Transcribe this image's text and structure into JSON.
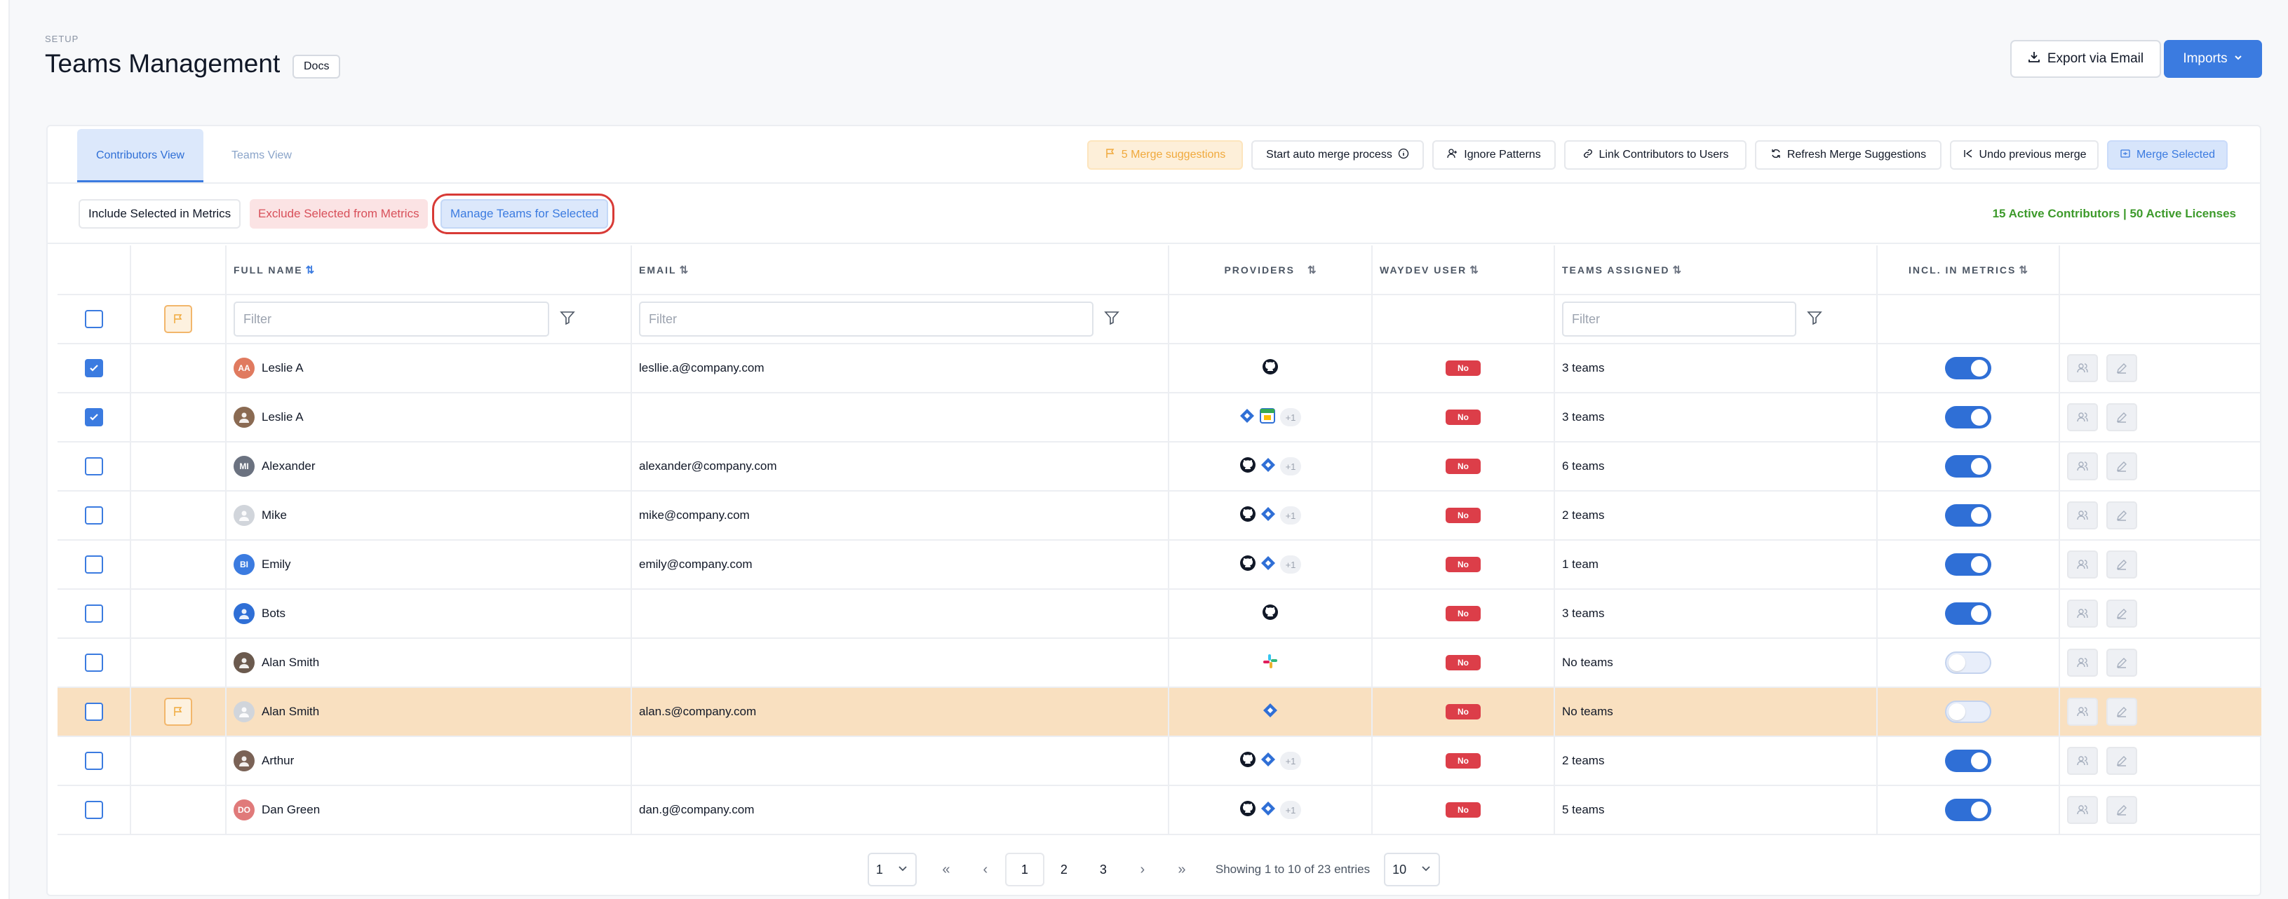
{
  "header": {
    "section": "SETUP",
    "title": "Teams Management",
    "docs_label": "Docs",
    "export_label": "Export via Email",
    "imports_label": "Imports"
  },
  "tabs": [
    {
      "label": "Contributors View",
      "active": true
    },
    {
      "label": "Teams View",
      "active": false
    }
  ],
  "toolbar": {
    "merge_suggestions": "5 Merge suggestions",
    "auto_merge": "Start auto merge process",
    "ignore_patterns": "Ignore Patterns",
    "link_contributors": "Link Contributors to Users",
    "refresh_merge": "Refresh Merge Suggestions",
    "undo_merge": "Undo previous merge",
    "merge_selected": "Merge Selected"
  },
  "actions": {
    "include_selected": "Include Selected in Metrics",
    "exclude_selected": "Exclude Selected from Metrics",
    "manage_teams": "Manage Teams for Selected",
    "active_summary": "15 Active Contributors | 50 Active Licenses"
  },
  "columns": {
    "full_name": "FULL NAME",
    "email": "EMAIL",
    "providers": "PROVIDERS",
    "waydev_user": "WAYDEV USER",
    "teams_assigned": "TEAMS ASSIGNED",
    "incl_in_metrics": "INCL. IN METRICS"
  },
  "filters": {
    "name_placeholder": "Filter",
    "email_placeholder": "Filter",
    "teams_placeholder": "Filter"
  },
  "colors": {
    "accent": "#3b7be0",
    "badge_no": "#dc3e49",
    "active_summary": "#3d9a2b",
    "highlight_row": "#f9e0c0"
  },
  "rows": [
    {
      "checked": true,
      "flag": false,
      "initials": "AA",
      "avatar_color": "#e07a5f",
      "name": "Leslie A",
      "email": "lesllie.a@company.com",
      "providers": [
        "github-icon"
      ],
      "extra": "",
      "waydev": "No",
      "teams": "3 teams",
      "metrics": true,
      "highlight": false
    },
    {
      "checked": true,
      "flag": false,
      "initials": "",
      "avatar_color": "#8a6a52",
      "name": "Leslie A",
      "email": "",
      "providers": [
        "jira-icon",
        "calendar-icon"
      ],
      "extra": "+1",
      "waydev": "No",
      "teams": "3 teams",
      "metrics": true,
      "highlight": false
    },
    {
      "checked": false,
      "flag": false,
      "initials": "MI",
      "avatar_color": "#6b7280",
      "name": "Alexander",
      "email": "alexander@company.com",
      "providers": [
        "github-icon",
        "jira-icon"
      ],
      "extra": "+1",
      "waydev": "No",
      "teams": "6 teams",
      "metrics": true,
      "highlight": false
    },
    {
      "checked": false,
      "flag": false,
      "initials": "",
      "avatar_color": "#d1d5db",
      "name": "Mike",
      "email": "mike@company.com",
      "providers": [
        "github-icon",
        "jira-icon"
      ],
      "extra": "+1",
      "waydev": "No",
      "teams": "2 teams",
      "metrics": true,
      "highlight": false
    },
    {
      "checked": false,
      "flag": false,
      "initials": "BI",
      "avatar_color": "#3b7be0",
      "name": "Emily",
      "email": "emily@company.com",
      "providers": [
        "github-icon",
        "jira-icon"
      ],
      "extra": "+1",
      "waydev": "No",
      "teams": "1 team",
      "metrics": true,
      "highlight": false
    },
    {
      "checked": false,
      "flag": false,
      "initials": "",
      "avatar_color": "#2f6fd6",
      "name": "Bots",
      "email": "",
      "providers": [
        "github-icon"
      ],
      "extra": "",
      "waydev": "No",
      "teams": "3 teams",
      "metrics": true,
      "highlight": false
    },
    {
      "checked": false,
      "flag": false,
      "initials": "",
      "avatar_color": "#6b5a4e",
      "name": "Alan Smith",
      "email": "",
      "providers": [
        "slack-icon"
      ],
      "extra": "",
      "waydev": "No",
      "teams": "No teams",
      "metrics": false,
      "highlight": false
    },
    {
      "checked": false,
      "flag": true,
      "initials": "",
      "avatar_color": "#d1d5db",
      "name": "Alan Smith",
      "email": "alan.s@company.com",
      "providers": [
        "jira-icon"
      ],
      "extra": "",
      "waydev": "No",
      "teams": "No teams",
      "metrics": false,
      "highlight": true
    },
    {
      "checked": false,
      "flag": false,
      "initials": "",
      "avatar_color": "#7a6256",
      "name": "Arthur",
      "email": "",
      "providers": [
        "github-icon",
        "jira-icon"
      ],
      "extra": "+1",
      "waydev": "No",
      "teams": "2 teams",
      "metrics": true,
      "highlight": false
    },
    {
      "checked": false,
      "flag": false,
      "initials": "DO",
      "avatar_color": "#e07a7a",
      "name": "Dan Green",
      "email": "dan.g@company.com",
      "providers": [
        "github-icon",
        "jira-icon"
      ],
      "extra": "+1",
      "waydev": "No",
      "teams": "5 teams",
      "metrics": true,
      "highlight": false
    }
  ],
  "pagination": {
    "page_select": "1",
    "pages": [
      "1",
      "2",
      "3"
    ],
    "current": "1",
    "info": "Showing 1 to 10 of 23 entries",
    "page_size": "10"
  }
}
